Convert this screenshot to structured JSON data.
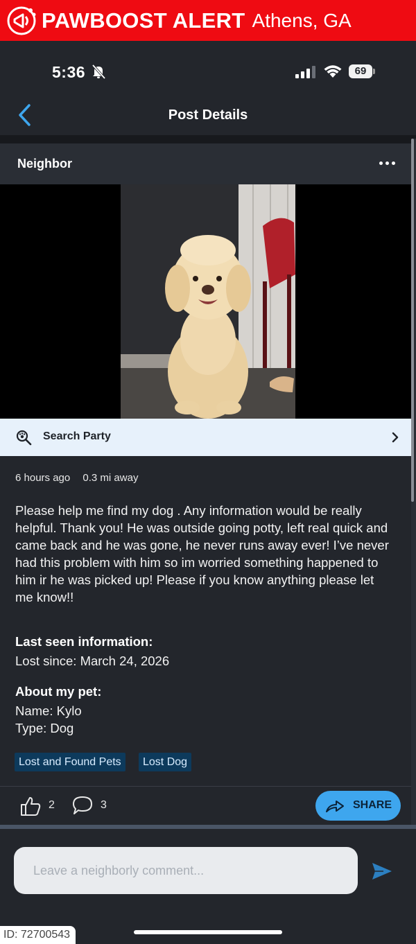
{
  "alert": {
    "brand": "PAWBOOST ALERT",
    "location": "Athens, GA",
    "icon": "megaphone-paw-icon",
    "color": "#ef0b12"
  },
  "status_bar": {
    "time": "5:36",
    "battery": "69"
  },
  "nav": {
    "title": "Post Details"
  },
  "post": {
    "author": "Neighbor",
    "search_party_label": "Search Party",
    "meta": {
      "posted": "6 hours ago",
      "distance": "0.3 mi away"
    },
    "body": "Please help me find my dog . Any information would be really helpful. Thank you! He was outside going potty, left real quick and came back and he was gone, he never runs away ever! I’ve never had this problem with him so im worried something happened to him ir he was picked up! Please if you know anything please let me know!!",
    "last_seen_title": "Last seen information:",
    "lost_since": "Lost since: March 24, 2026",
    "about_title": "About my pet:",
    "pet_name": "Name: Kylo",
    "pet_type": "Type: Dog",
    "tags": [
      "Lost and Found Pets",
      "Lost Dog"
    ],
    "likes": "2",
    "comments": "3",
    "share_label": "SHARE"
  },
  "comment_box": {
    "placeholder": "Leave a neighborly comment..."
  },
  "footer_id": "ID: 72700543",
  "colors": {
    "background": "#23262c",
    "accent": "#3ea6ee",
    "tag_bg": "#0d3a5c",
    "search_party_bg": "#e7f1fb"
  }
}
